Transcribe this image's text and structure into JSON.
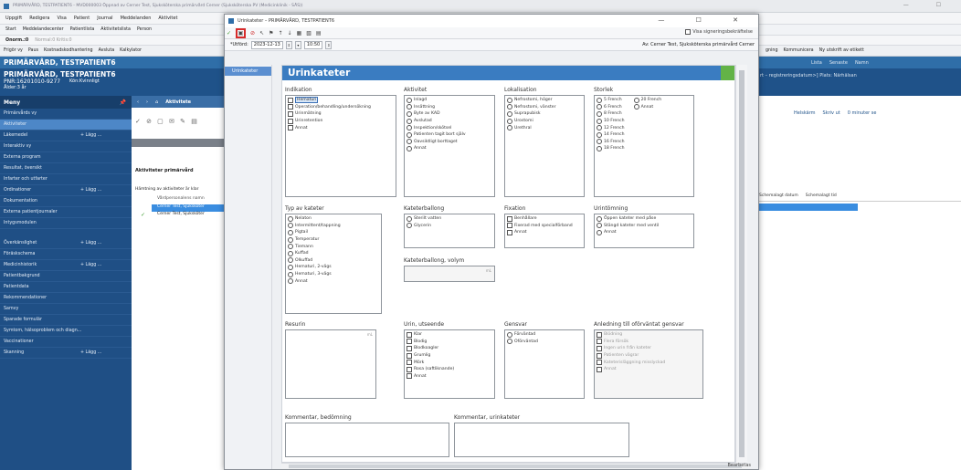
{
  "bg": {
    "titlebar": "PRIMÄRVÅRD, TESTPATIENT6 - MVD000003 Öppnad av Cerner Test, Sjuksköterska primärvård Cerner (Sjuksköterska PV (Medicinklinik - SÄS))",
    "window_controls": "— ☐",
    "menu": [
      "Uppgift",
      "Redigera",
      "Visa",
      "Patient",
      "Journal",
      "Meddelanden",
      "Aktivitet"
    ],
    "toolbar1": [
      "Start",
      "Meddelandecenter",
      "Patientlista",
      "Aktivitetslista",
      "Person"
    ],
    "toolbar2_label": "Onorm.:0",
    "toolbar2_rest": "Normal:0  Kritis:0",
    "toolbar3": [
      "Frigör vy",
      "Paus",
      "Kostnadskodhantering",
      "Avsluta",
      "Kalkylator"
    ],
    "toolbar3_right": [
      "gning",
      "Kommunicera",
      "Ny utskrift av etikett"
    ],
    "banner": "PRIMÄRVÅRD, TESTPATIENT6",
    "banner_right": [
      "Lista",
      "Senaste",
      "Namn"
    ],
    "patient_name": "PRIMÄRVÅRD, TESTPATIENT6",
    "pnr": "PNR:16201010-9277",
    "kon": "Kön:Kvinnligt",
    "age": "Ålder:3 år",
    "patient_right": "rt – registreringsdatum>] Plats: Närhälsan",
    "right_tools": [
      "Helskärm",
      "Skriv ut",
      "0 minuter se"
    ],
    "right_cols": [
      "Schemalagt datum",
      "Schemalagt tid"
    ]
  },
  "sidebar": {
    "menu_label": "Meny",
    "items": [
      {
        "label": "Primärvårds vy",
        "add": ""
      },
      {
        "label": "Aktiviteter",
        "add": "",
        "active": true
      },
      {
        "label": "Läkemedel",
        "add": "+ Lägg ..."
      },
      {
        "label": "Interaktiv vy",
        "add": ""
      },
      {
        "label": "Externa program",
        "add": ""
      },
      {
        "label": "Resultat, översikt",
        "add": ""
      },
      {
        "label": "Infarter och utfarter",
        "add": ""
      },
      {
        "label": "Ordinationer",
        "add": "+ Lägg ..."
      },
      {
        "label": "Dokumentation",
        "add": ""
      },
      {
        "label": "Externa patientjournaler",
        "add": ""
      },
      {
        "label": "Intygsmodulen",
        "add": ""
      }
    ],
    "items2": [
      {
        "label": "Överkänslighet",
        "add": "+ Lägg ..."
      },
      {
        "label": "Föräskschema",
        "add": ""
      },
      {
        "label": "Medicinhistorik",
        "add": "+ Lägg ..."
      },
      {
        "label": "Patientbakgrund",
        "add": ""
      },
      {
        "label": "Patientdata",
        "add": ""
      },
      {
        "label": "Rekommendationer",
        "add": ""
      },
      {
        "label": "Samvy",
        "add": ""
      },
      {
        "label": "Sparade formulär",
        "add": ""
      },
      {
        "label": "Symtom, hälsoproblem och diagn...",
        "add": ""
      },
      {
        "label": "Vaccinationer",
        "add": ""
      },
      {
        "label": "Skanning",
        "add": "+ Lägg ..."
      }
    ]
  },
  "center": {
    "nav_label": "Aktivitete",
    "heading": "Aktiviteter primärvård",
    "filter": "Hämtning av aktiviteter är klar",
    "col_header": "Vårdpersonalens namn",
    "rows": [
      "Cerner Test, Sjuksköter",
      "Cerner Test, Sjuksköter"
    ]
  },
  "dialog": {
    "title": "Urinkateter – PRIMÄRVÅRD, TESTPATIENT6",
    "controls": "— ☐ ✕",
    "sign_label": "Visa signeringsbekräftelse",
    "date_label": "*Utförd:",
    "date_value": "2023-12-13",
    "time_value": "10:50",
    "author": "Av: Cerner Test, Sjuksköterska primärvård Cerner",
    "nav_item": "Urinkateter",
    "form_title": "Urinkateter",
    "status": "Bearbetas",
    "sections": {
      "indikation": {
        "label": "Indikation",
        "options": [
          "Hematuri",
          "Operation/behandling/undersökning",
          "Urinmätning",
          "Urinretention",
          "Annat"
        ]
      },
      "aktivitet": {
        "label": "Aktivitet",
        "options": [
          "Inlagd",
          "Insättning",
          "Byte av KAD",
          "Avslutad",
          "Inspektion/skötsel",
          "Patienten tagit bort själv",
          "Oavsiktligt borttaget",
          "Annat"
        ]
      },
      "lokalisation": {
        "label": "Lokalisation",
        "options": [
          "Nefrostomi, höger",
          "Nefrostomi, vänster",
          "Suprapubisk",
          "Urostomi",
          "Urethral"
        ]
      },
      "storlek": {
        "label": "Storlek",
        "col1": [
          "5 French",
          "6 French",
          "8 French",
          "10 French",
          "12 French",
          "14 French",
          "16 French",
          "18 French"
        ],
        "col2": [
          "20 French",
          "Annat"
        ]
      },
      "typ": {
        "label": "Typ av kateter",
        "options": [
          "Nelaton",
          "Intermittent/tappning",
          "Pigtail",
          "Temperatur",
          "Tiemann",
          "Kuffad",
          "Olkuffad",
          "Hematuri, 2-vägs",
          "Hematuri, 3-vägs",
          "Annat"
        ]
      },
      "ballong": {
        "label": "Kateterballong",
        "options": [
          "Sterilt vatten",
          "Glycerin"
        ]
      },
      "fixation": {
        "label": "Fixation",
        "options": [
          "Benhållare",
          "Fixerad med specialförband",
          "Annat"
        ]
      },
      "urintomning": {
        "label": "Urintömning",
        "options": [
          "Öppen kateter med påse",
          "Stängd kateter med ventil",
          "Annat"
        ]
      },
      "volym": {
        "label": "Kateterballong, volym",
        "unit": "mL"
      },
      "resurin": {
        "label": "Resurin",
        "unit": "mL"
      },
      "urin": {
        "label": "Urin, utseende",
        "options": [
          "Klar",
          "Blodig",
          "Blodkoagler",
          "Grumlig",
          "Mörk",
          "Rosa (saftliknande)",
          "Annat"
        ]
      },
      "gensvar": {
        "label": "Gensvar",
        "options": [
          "Förväntad",
          "Oförväntad"
        ]
      },
      "anledning": {
        "label": "Anledning till oförväntat gensvar",
        "options": [
          "Blödning",
          "Flera försök",
          "Ingen urin från kateter",
          "Patienten vägrar",
          "Kateterisläggning misslyckad",
          "Annat"
        ]
      },
      "kommentar1": {
        "label": "Kommentar, bedömning"
      },
      "kommentar2": {
        "label": "Kommentar, urinkateter"
      }
    }
  },
  "colors": {
    "accent": "#3a7cc1",
    "sidebar": "#1f4f85",
    "save_highlight": "#d62b2b",
    "green_marker": "#63b347"
  }
}
